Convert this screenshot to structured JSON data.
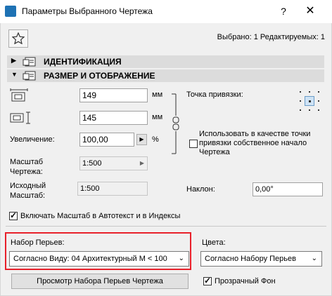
{
  "window": {
    "title": "Параметры Выбранного Чертежа",
    "help": "?",
    "close": "✕"
  },
  "selection_info": "Выбрано: 1 Редактируемых: 1",
  "panels": {
    "identification": "ИДЕНТИФИКАЦИЯ",
    "size_display": "РАЗМЕР И ОТОБРАЖЕНИЕ"
  },
  "size": {
    "width_value": "149",
    "height_value": "145",
    "unit_mm": "мм",
    "zoom_label": "Увеличение:",
    "zoom_value": "100,00",
    "zoom_unit": "%",
    "drawing_scale_label": "Масштаб\nЧертежа:",
    "drawing_scale_value": "1:500",
    "source_scale_label": "Исходный\nМасштаб:",
    "source_scale_value": "1:500",
    "anchor_label": "Точка привязки:",
    "use_origin_label": "Использовать в качестве точки привязки собственное начало Чертежа",
    "use_origin_checked": false,
    "tilt_label": "Наклон:",
    "tilt_value": "0,00°",
    "autotext_label": "Включать Масштаб в Автотекст и в Индексы",
    "autotext_checked": true
  },
  "pens": {
    "label": "Набор Перьев:",
    "selected": "Согласно Виду: 04 Архитектурный М < 100",
    "preview_button": "Просмотр Набора Перьев Чертежа"
  },
  "colors": {
    "label": "Цвета:",
    "selected": "Согласно Набору Перьев",
    "transparent_label": "Прозрачный Фон",
    "transparent_checked": true
  },
  "accent": {
    "highlight": "#e8202a",
    "app_icon": "#1e72b4"
  }
}
